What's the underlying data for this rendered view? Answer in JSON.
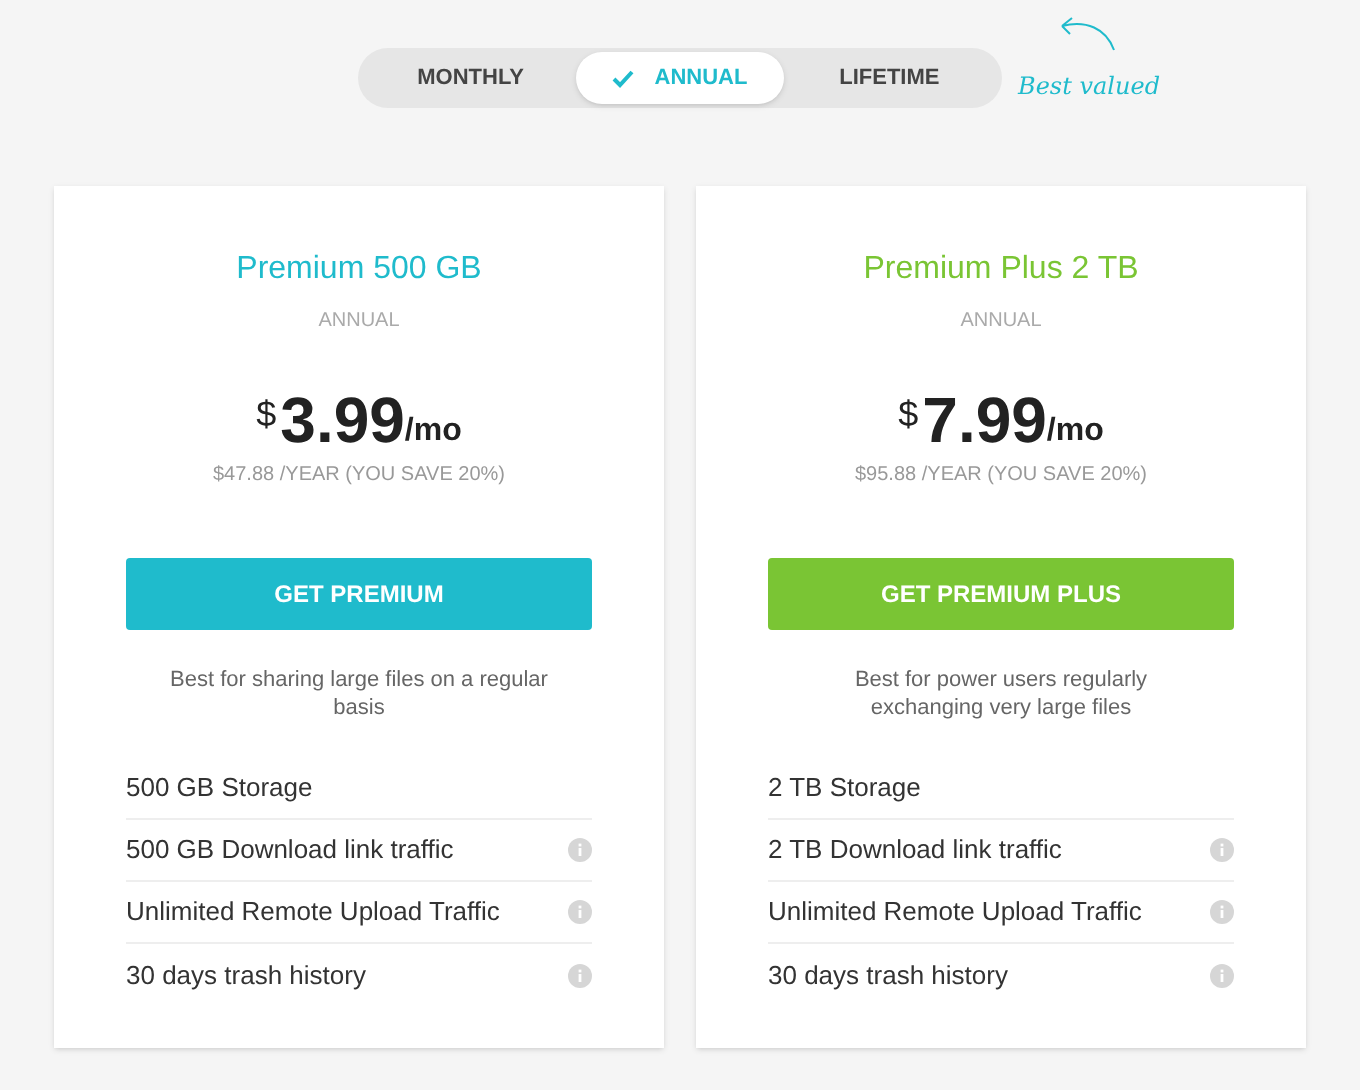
{
  "billing_toggle": [
    {
      "label": "MONTHLY",
      "selected": false
    },
    {
      "label": "ANNUAL",
      "selected": true
    },
    {
      "label": "LIFETIME",
      "selected": false
    }
  ],
  "best_value_note": "Best valued",
  "plans": [
    {
      "name": "Premium 500 GB",
      "color": "#1fbbcc",
      "period": "ANNUAL",
      "currency": "$",
      "price": "3.99",
      "unit": "/mo",
      "yearly": "$47.88 /YEAR (YOU SAVE 20%)",
      "button": "GET PREMIUM",
      "description": "Best for sharing large files on a regular basis",
      "features": [
        {
          "text": "500 GB Storage",
          "info": false
        },
        {
          "text": "500 GB Download link traffic",
          "info": true
        },
        {
          "text": "Unlimited Remote Upload Traffic",
          "info": true
        },
        {
          "text": "30 days trash history",
          "info": true
        }
      ]
    },
    {
      "name": "Premium Plus 2 TB",
      "color": "#7ac534",
      "period": "ANNUAL",
      "currency": "$",
      "price": "7.99",
      "unit": "/mo",
      "yearly": "$95.88 /YEAR (YOU SAVE 20%)",
      "button": "GET PREMIUM PLUS",
      "description": "Best for power users regularly exchanging very large files",
      "features": [
        {
          "text": "2 TB Storage",
          "info": false
        },
        {
          "text": "2 TB Download link traffic",
          "info": true
        },
        {
          "text": "Unlimited Remote Upload Traffic",
          "info": true
        },
        {
          "text": "30 days trash history",
          "info": true
        }
      ]
    }
  ]
}
